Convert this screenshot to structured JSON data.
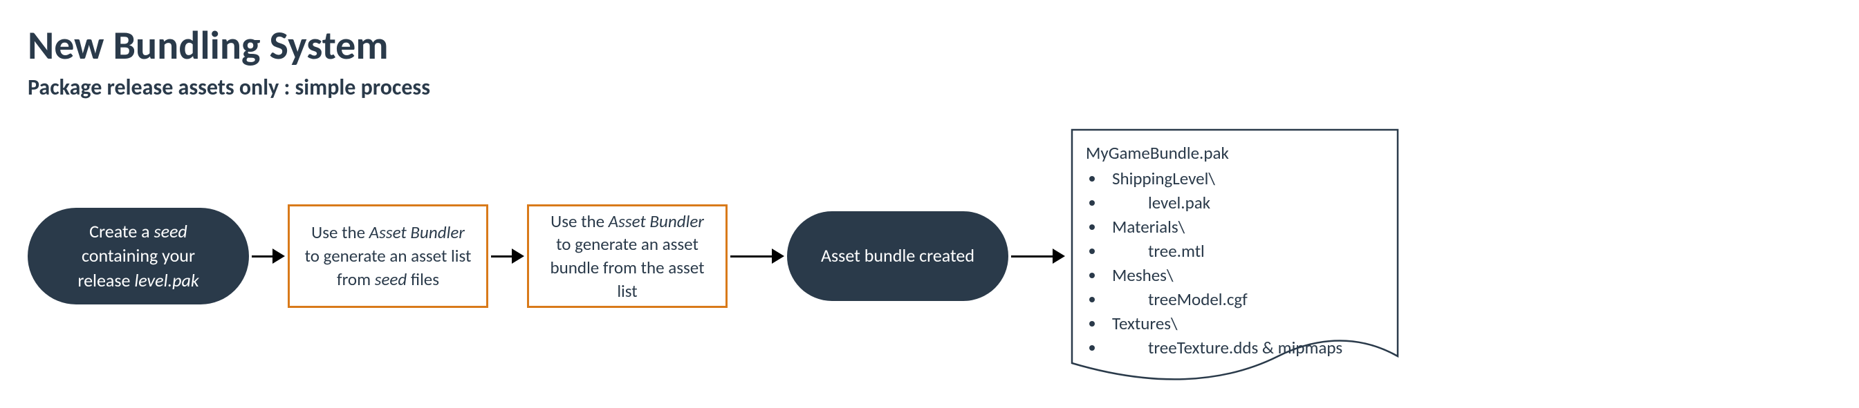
{
  "title": "New Bundling System",
  "subtitle": "Package release assets only : simple process",
  "steps": {
    "s1_pre": "Create a ",
    "s1_em1": "seed",
    "s1_mid": " containing your release ",
    "s1_em2": "level.pak",
    "s2_pre": "Use the ",
    "s2_em1": "Asset Bundler",
    "s2_mid": " to generate an asset list from ",
    "s2_em2": "seed",
    "s2_post": " files",
    "s3_pre": "Use the ",
    "s3_em1": "Asset Bundler",
    "s3_post": " to generate an asset bundle from the asset list",
    "s4": "Asset bundle created"
  },
  "doc": {
    "filename": "MyGameBundle.pak",
    "items": [
      {
        "text": "ShippingLevel\\",
        "indent": 1
      },
      {
        "text": "level.pak",
        "indent": 2
      },
      {
        "text": "Materials\\",
        "indent": 1
      },
      {
        "text": "tree.mtl",
        "indent": 2
      },
      {
        "text": "Meshes\\",
        "indent": 1
      },
      {
        "text": "treeModel.cgf",
        "indent": 2
      },
      {
        "text": "Textures\\",
        "indent": 1
      },
      {
        "text": "treeTexture.dds & mipmaps",
        "indent": 2
      }
    ]
  },
  "colors": {
    "dark": "#2a3a4a",
    "orange": "#d97a1a"
  }
}
